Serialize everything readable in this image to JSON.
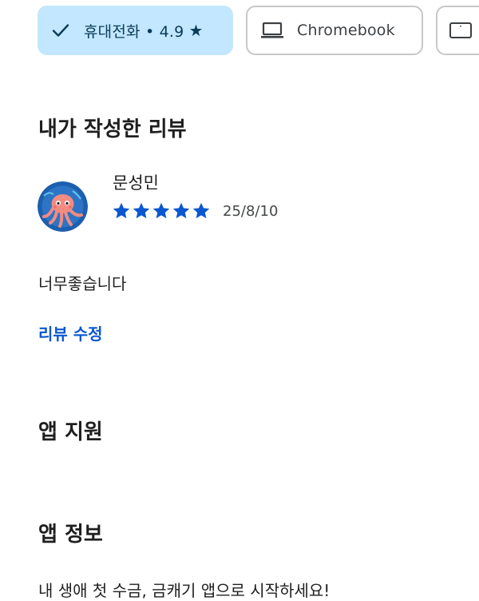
{
  "filter_chips": [
    {
      "label": "휴대전화 • 4.9",
      "icon": "check-icon",
      "trailing_icon": "star-icon",
      "star_glyph": "★",
      "selected": true
    },
    {
      "label": "Chromebook",
      "icon": "laptop-icon",
      "selected": false
    },
    {
      "label": "",
      "icon": "tablet-icon",
      "selected": false
    }
  ],
  "my_review": {
    "title": "내가 작성한 리뷰",
    "reviewer_name": "문성민",
    "avatar_icon": "octopus-avatar",
    "rating": 5,
    "rating_max": 5,
    "date": "25/8/10",
    "text": "너무좋습니다",
    "edit_link": "리뷰 수정"
  },
  "app_support": {
    "title": "앱 지원"
  },
  "app_info": {
    "title": "앱 정보",
    "description": "내 생애 첫 수금, 금캐기 앱으로 시작하세요!"
  },
  "colors": {
    "selected_chip_bg": "#c2e7ff",
    "accent_blue": "#0b57d0",
    "star_blue": "#0b57d0",
    "text_primary": "#1f1f1f",
    "chip_border": "#c7c7c7"
  }
}
